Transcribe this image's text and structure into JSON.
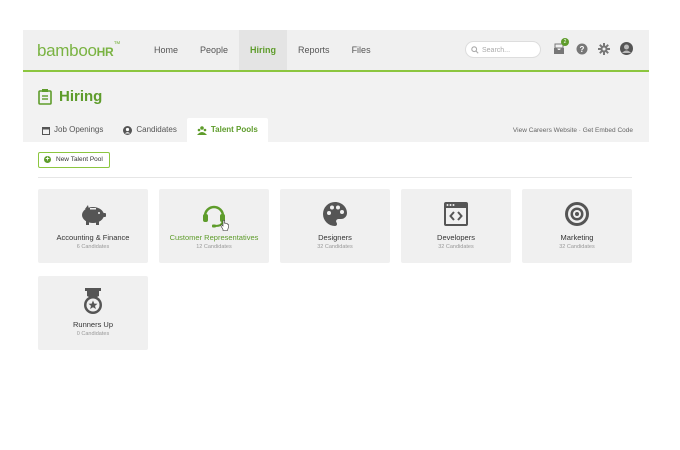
{
  "header": {
    "logo_main": "bamboo",
    "logo_hr": "HR",
    "logo_tm": "™",
    "nav": [
      "Home",
      "People",
      "Hiring",
      "Reports",
      "Files"
    ],
    "active_nav": "Hiring",
    "search_placeholder": "Search...",
    "notification_count": "2"
  },
  "page": {
    "title": "Hiring",
    "tabs": [
      "Job Openings",
      "Candidates",
      "Talent Pools"
    ],
    "active_tab": "Talent Pools",
    "links": "View Careers Website · Get Embed Code",
    "new_button": "New Talent Pool"
  },
  "pools": [
    {
      "name": "Accounting & Finance",
      "count": "6 Candidates",
      "icon": "piggy-bank-icon"
    },
    {
      "name": "Customer Representatives",
      "count": "12 Candidates",
      "icon": "headset-icon"
    },
    {
      "name": "Designers",
      "count": "32 Candidates",
      "icon": "palette-icon"
    },
    {
      "name": "Developers",
      "count": "32 Candidates",
      "icon": "code-window-icon"
    },
    {
      "name": "Marketing",
      "count": "32 Candidates",
      "icon": "target-icon"
    },
    {
      "name": "Runners Up",
      "count": "0 Candidates",
      "icon": "medal-icon"
    }
  ],
  "colors": {
    "accent": "#5e9c2b",
    "accent_light": "#8cc63f",
    "card_bg": "#f0f0f0"
  }
}
